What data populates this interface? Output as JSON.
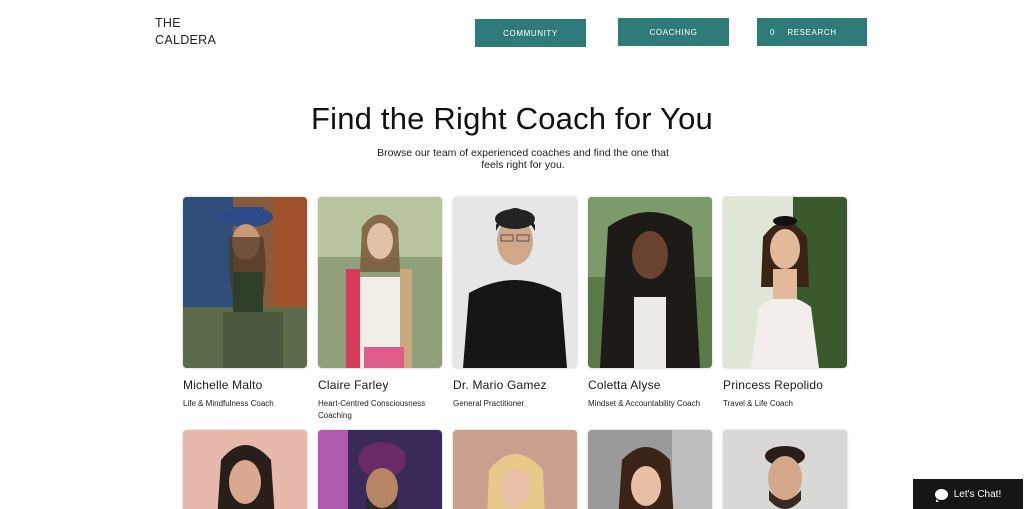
{
  "header": {
    "logo_line1": "THE",
    "logo_line2": "CALDERA",
    "nav": {
      "community": "COMMUNITY",
      "coaching": "COACHING",
      "research": "RESEARCH",
      "cart_count": "0"
    }
  },
  "hero": {
    "title": "Find the Right Coach for You",
    "subtitle_line1": "Browse our team of experienced coaches and find the one that",
    "subtitle_line2": "feels right for you."
  },
  "coaches": [
    {
      "name": "Michelle Malto",
      "role": "Life & Mindfulness Coach"
    },
    {
      "name": "Claire Farley",
      "role": "Heart-Centred Consciousness Coaching"
    },
    {
      "name": "Dr. Mario Gamez",
      "role": "General Practitioner"
    },
    {
      "name": "Coletta Alyse",
      "role": "Mindset & Accountability Coach"
    },
    {
      "name": "Princess Repolido",
      "role": "Travel & Life Coach"
    }
  ],
  "chat": {
    "label": "Let's Chat!"
  },
  "colors": {
    "accent": "#2f7b7a",
    "chat_bg": "#161616"
  }
}
